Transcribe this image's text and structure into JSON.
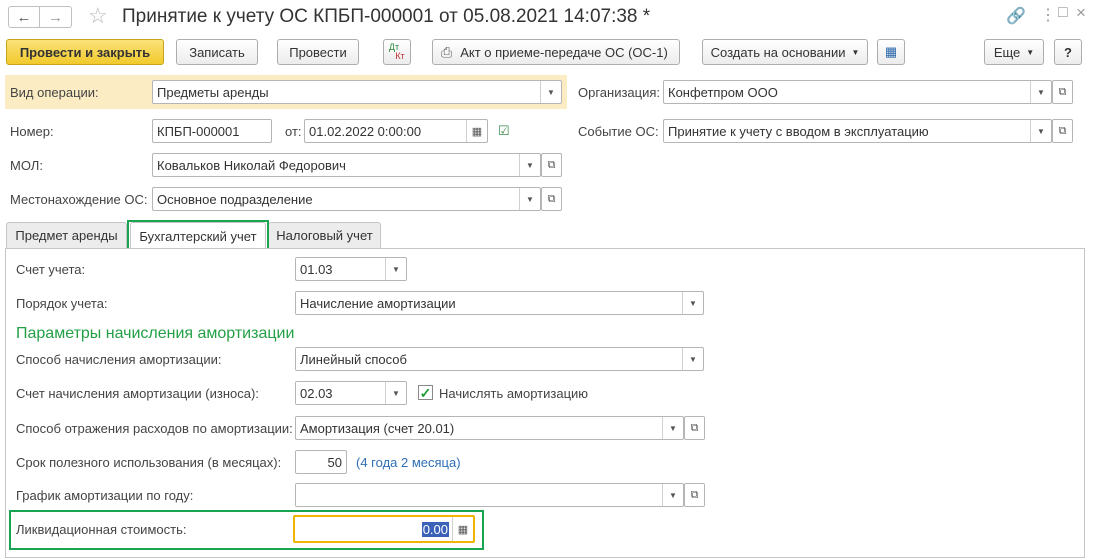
{
  "window": {
    "title": "Принятие к учету ОС КПБП-000001 от 05.08.2021 14:07:38 *",
    "modified_marker": "*"
  },
  "toolbar": {
    "post_close_label": "Провести и закрыть",
    "save_label": "Записать",
    "post_label": "Провести",
    "dtkt_top": "Дт",
    "dtkt_bottom": "Кт",
    "print_act_label": "Акт о приеме-передаче ОС (ОС-1)",
    "create_based_label": "Создать на основании",
    "more_label": "Еще",
    "help_label": "?"
  },
  "header": {
    "operation_type_label": "Вид операции:",
    "operation_type_value": "Предметы аренды",
    "organization_label": "Организация:",
    "organization_value": "Конфетпром ООО",
    "number_label": "Номер:",
    "number_value": "КПБП-000001",
    "date_from_label": "от:",
    "date_value": "01.02.2022  0:00:00",
    "event_label": "Событие ОС:",
    "event_value": "Принятие к учету с вводом в эксплуатацию",
    "mol_label": "МОЛ:",
    "mol_value": "Ковальков Николай Федорович",
    "location_label": "Местонахождение ОС:",
    "location_value": "Основное подразделение"
  },
  "tabs": [
    {
      "label": "Предмет аренды",
      "active": false
    },
    {
      "label": "Бухгалтерский учет",
      "active": true
    },
    {
      "label": "Налоговый учет",
      "active": false
    }
  ],
  "accounting": {
    "account_label": "Счет учета:",
    "account_value": "01.03",
    "order_label": "Порядок учета:",
    "order_value": "Начисление амортизации",
    "section_title": "Параметры начисления амортизации",
    "method_label": "Способ начисления амортизации:",
    "method_value": "Линейный способ",
    "dep_account_label": "Счет начисления амортизации (износа):",
    "dep_account_value": "02.03",
    "accrue_label": "Начислять амортизацию",
    "accrue_checked": true,
    "expense_label": "Способ отражения расходов по амортизации:",
    "expense_value": "Амортизация (счет 20.01)",
    "useful_life_label": "Срок полезного использования (в месяцах):",
    "useful_life_value": "50",
    "useful_life_hint": "(4 года 2 месяца)",
    "schedule_label": "График амортизации по году:",
    "schedule_value": "",
    "salvage_label": "Ликвидационная стоимость:",
    "salvage_value": "0.00"
  },
  "colors": {
    "primary_button": "#f5d13a",
    "highlight_row": "#fbecc4",
    "section_green": "#23a046",
    "annotation_green": "#1aa350",
    "hint_blue": "#2e6fb7",
    "focus_border": "#f2b400"
  }
}
